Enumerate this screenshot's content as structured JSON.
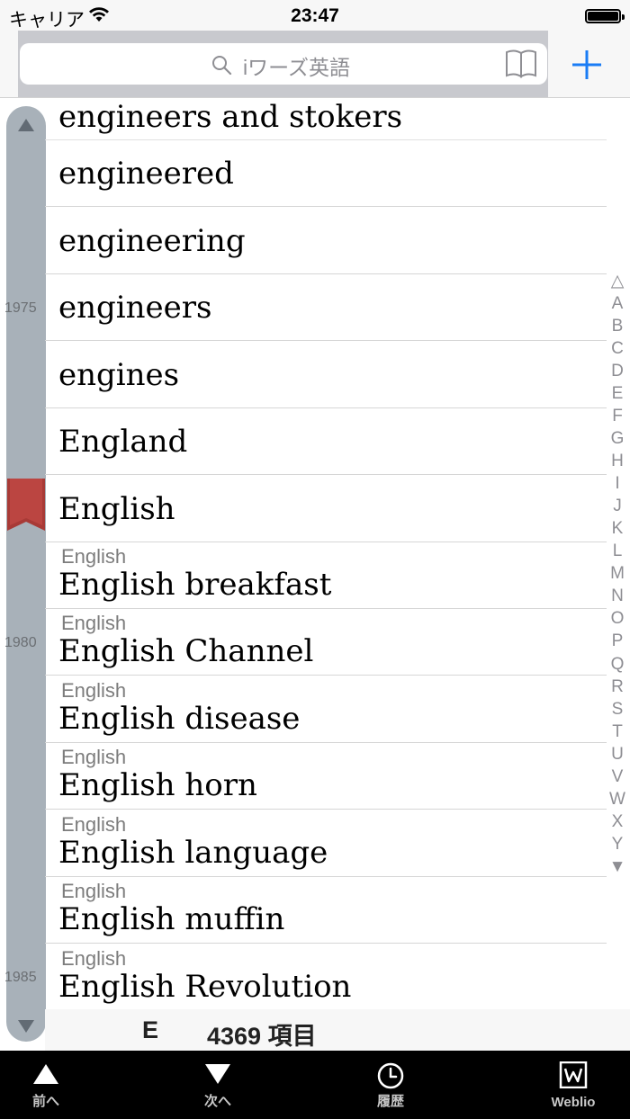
{
  "status_bar": {
    "carrier": "キャリア",
    "time": "23:47"
  },
  "search": {
    "placeholder": "iワーズ英語"
  },
  "rail": {
    "markers": [
      "1975",
      "1980",
      "1985"
    ]
  },
  "entries": [
    {
      "word": "engineers and stokers"
    },
    {
      "word": "engineered"
    },
    {
      "word": "engineering"
    },
    {
      "word": "engineers"
    },
    {
      "word": "engines"
    },
    {
      "word": "England"
    },
    {
      "word": "English"
    },
    {
      "category": "English",
      "word": "English breakfast"
    },
    {
      "category": "English",
      "word": "English Channel"
    },
    {
      "category": "English",
      "word": "English disease"
    },
    {
      "category": "English",
      "word": "English horn"
    },
    {
      "category": "English",
      "word": "English language"
    },
    {
      "category": "English",
      "word": "English muffin"
    },
    {
      "category": "English",
      "word": "English Revolution"
    }
  ],
  "alphabet_index": [
    "△",
    "A",
    "B",
    "C",
    "D",
    "E",
    "F",
    "G",
    "H",
    "I",
    "J",
    "K",
    "L",
    "M",
    "N",
    "O",
    "P",
    "Q",
    "R",
    "S",
    "T",
    "U",
    "V",
    "W",
    "X",
    "Y",
    "▼"
  ],
  "footer": {
    "letter": "E",
    "count": "4369 項目"
  },
  "toolbar": {
    "prev": "前へ",
    "next": "次へ",
    "history": "履歴",
    "weblio": "Weblio"
  },
  "colors": {
    "accent": "#1a7cf5",
    "rail": "#a8b1b9",
    "bookmark": "#a83a36",
    "toolbar": "#000000"
  }
}
